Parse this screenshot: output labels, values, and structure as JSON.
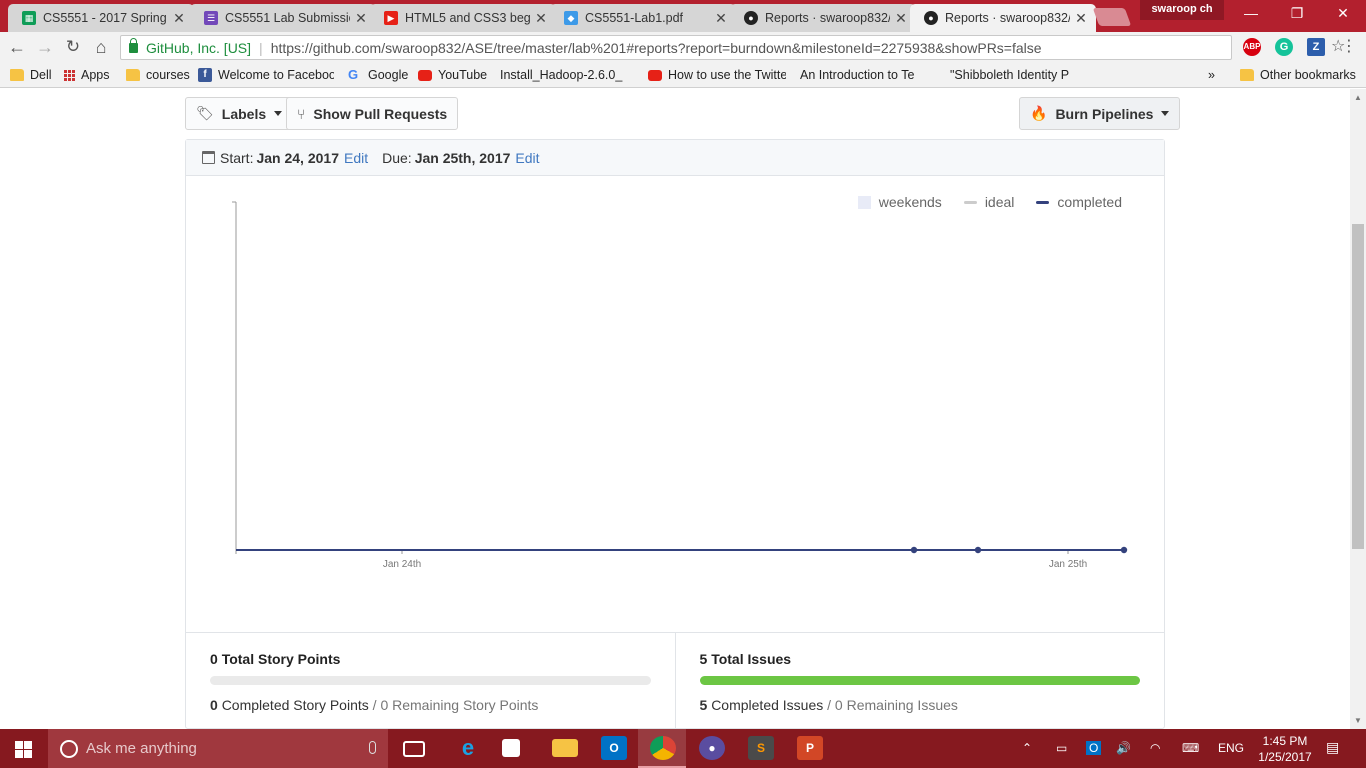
{
  "browser": {
    "tabs": [
      {
        "title": "CS5551 - 2017 Spring",
        "icon": "sheets-icon",
        "color": "#0f9d58"
      },
      {
        "title": "CS5551 Lab Submissio",
        "icon": "forms-icon",
        "color": "#7248b9"
      },
      {
        "title": "HTML5 and CSS3 begi",
        "icon": "youtube-icon",
        "color": "#e62117"
      },
      {
        "title": "CS5551-Lab1.pdf",
        "icon": "dropbox-icon",
        "color": "#3d9ae8"
      },
      {
        "title": "Reports · swaroop832/",
        "icon": "github-icon",
        "color": "#222222"
      },
      {
        "title": "Reports · swaroop832/",
        "icon": "github-icon",
        "color": "#222222"
      }
    ],
    "profile_name": "swaroop ch",
    "security_label": "GitHub, Inc. [US]",
    "url_host": "https://github.com",
    "url_path": "/swaroop832/ASE/tree/master/lab%201#reports?report=burndown&milestoneId=2275938&showPRs=false",
    "extensions": [
      {
        "name": "adblock-plus",
        "label": "ABP",
        "color": "#d7000f"
      },
      {
        "name": "grammarly",
        "label": "G",
        "color": "#15c39a"
      },
      {
        "name": "zenhub",
        "label": "Z",
        "color": "#2d5eac"
      }
    ]
  },
  "bookmarks": {
    "items": [
      "Dell",
      "Apps",
      "courses",
      "Welcome to Faceboo",
      "Google",
      "YouTube",
      "Install_Hadoop-2.6.0_",
      "How to use the Twitte",
      "An Introduction to Te",
      "\"Shibboleth Identity P"
    ],
    "overflow": "»",
    "other": "Other bookmarks"
  },
  "toolbar": {
    "labels_button": "Labels",
    "pull_requests_button": "Show Pull Requests",
    "pipelines_button": "Burn Pipelines"
  },
  "milestone": {
    "start_label": "Start:",
    "start_date": "Jan 24, 2017",
    "start_edit": "Edit",
    "due_label": "Due:",
    "due_date": "Jan 25th, 2017",
    "due_edit": "Edit"
  },
  "chart_data": {
    "type": "line",
    "x_ticks": [
      "Jan 24th",
      "Jan 25th"
    ],
    "series": [
      {
        "name": "weekends",
        "color": "#e8ebf7",
        "values": []
      },
      {
        "name": "ideal",
        "color": "#cccccc",
        "values": []
      },
      {
        "name": "completed",
        "color": "#34427d",
        "points": [
          {
            "x": "Jan 24th",
            "y": 0
          },
          {
            "x": "Jan 25th",
            "y": 0
          }
        ]
      }
    ],
    "grid": false,
    "legend_position": "top-right"
  },
  "stats": {
    "story_points": {
      "total": "0",
      "total_label": "Total Story Points",
      "completed": "0",
      "completed_label": "Completed Story Points",
      "remaining": "0",
      "remaining_label": "Remaining Story Points",
      "progress_fraction": 0
    },
    "issues": {
      "total": "5",
      "total_label": "Total Issues",
      "completed": "5",
      "completed_label": "Completed Issues",
      "remaining": "0",
      "remaining_label": "Remaining Issues",
      "progress_fraction": 1
    }
  },
  "taskbar": {
    "search_placeholder": "Ask me anything",
    "apps": [
      "task-view",
      "edge",
      "store",
      "file-explorer",
      "outlook",
      "chrome",
      "zenhub-app",
      "sublime-text",
      "powerpoint"
    ],
    "language": "ENG",
    "time": "1:45 PM",
    "date": "1/25/2017"
  }
}
